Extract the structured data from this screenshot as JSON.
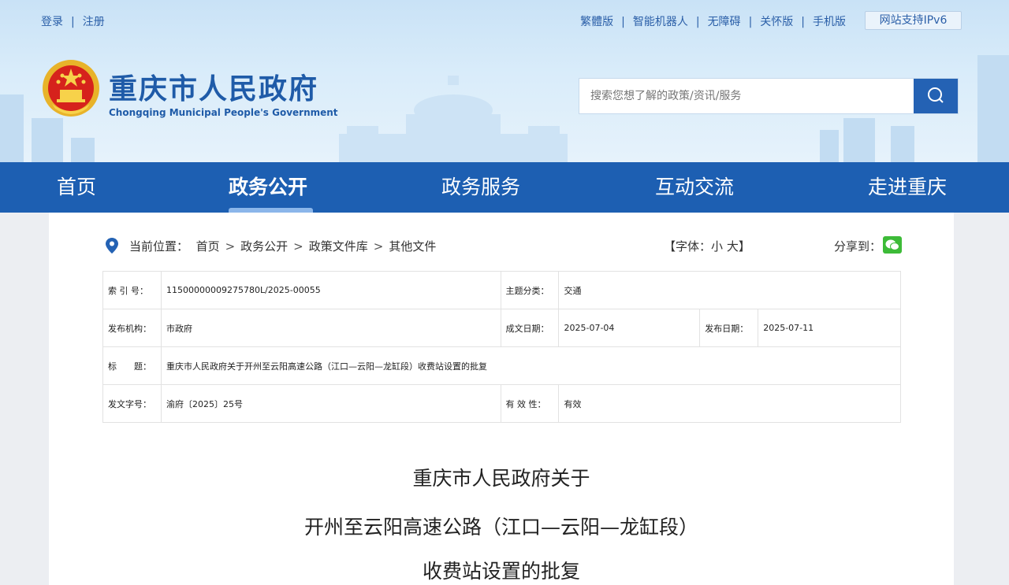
{
  "topbar": {
    "login": "登录",
    "register": "注册",
    "links": [
      "繁體版",
      "智能机器人",
      "无障碍",
      "关怀版",
      "手机版"
    ],
    "ipv6": "网站支持IPv6"
  },
  "site": {
    "title": "重庆市人民政府",
    "subtitle": "Chongqing Municipal People's Government"
  },
  "search": {
    "placeholder": "搜索您想了解的政策/资讯/服务"
  },
  "nav": [
    "首页",
    "政务公开",
    "政务服务",
    "互动交流",
    "走进重庆"
  ],
  "breadcrumb": {
    "label": "当前位置：",
    "items": [
      "首页",
      "政务公开",
      "政策文件库",
      "其他文件"
    ],
    "arrow": ">"
  },
  "fontsize": {
    "prefix": "【字体：",
    "small": "小",
    "large": "大",
    "suffix": "】"
  },
  "share": {
    "label": "分享到："
  },
  "meta": {
    "index_label": "索 引 号：",
    "index_value": "11500000009275780L/2025-00055",
    "topic_label": "主题分类：",
    "topic_value": "交通",
    "org_label": "发布机构：",
    "org_value": "市政府",
    "made_label": "成文日期：",
    "made_value": "2025-07-04",
    "pub_label": "发布日期：",
    "pub_value": "2025-07-11",
    "title_label": "标　　题：",
    "title_value": "重庆市人民政府关于开州至云阳高速公路（江口—云阳—龙缸段）收费站设置的批复",
    "docno_label": "发文字号：",
    "docno_value": "渝府〔2025〕25号",
    "valid_label": "有 效 性：",
    "valid_value": "有效"
  },
  "document": {
    "title_lines": [
      "重庆市人民政府关于",
      "开州至云阳高速公路（江口—云阳—龙缸段）",
      "收费站设置的批复"
    ]
  },
  "colors": {
    "nav": "#1d5fb2",
    "brand": "#1f5ba8",
    "search_button": "#2462b4",
    "wechat": "#3dbb38"
  }
}
